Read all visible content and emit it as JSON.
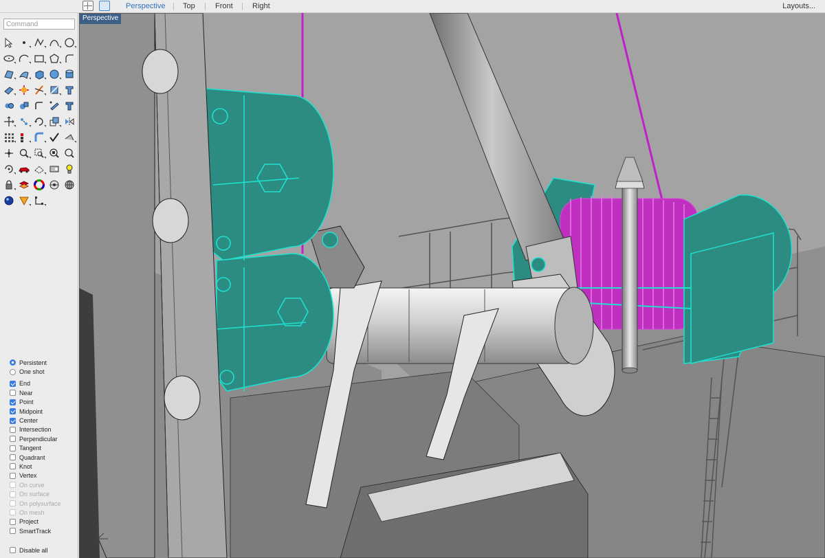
{
  "viewport_tabs": [
    {
      "label": "Perspective",
      "active": true
    },
    {
      "label": "Top",
      "active": false
    },
    {
      "label": "Front",
      "active": false
    },
    {
      "label": "Right",
      "active": false
    }
  ],
  "layouts_label": "Layouts...",
  "command": {
    "placeholder": "Command",
    "value": ""
  },
  "viewport": {
    "label": "Perspective"
  },
  "tools": [
    "select-arrow-icon",
    "point-icon",
    "polyline-icon",
    "curve-icon",
    "circle-icon",
    "ellipse-icon",
    "arc-icon",
    "rectangle-icon",
    "polygon-icon",
    "fillet-curve-icon",
    "surface-corner-points-icon",
    "extrude-surface-icon",
    "box-solid-icon",
    "sphere-icon",
    "cylinder-icon",
    "mesh-plane-icon",
    "explode-icon",
    "trim-icon",
    "split-icon",
    "text-object-icon",
    "join-icon",
    "boolean-union-icon",
    "fillet-edge-icon",
    "edit-points-icon",
    "text-icon",
    "move-icon",
    "copy-icon",
    "rotate-icon",
    "scale-icon",
    "mirror-icon",
    "array-icon",
    "group-icon",
    "bend-icon",
    "check-icon",
    "distance-icon",
    "pan-icon",
    "zoom-icon",
    "zoom-window-icon",
    "zoom-extents-icon",
    "zoom-selected-icon",
    "rotate-view-icon",
    "car-render-icon",
    "named-view-icon",
    "display-mode-icon",
    "light-bulb-icon",
    "lock-icon",
    "layer-icon",
    "color-wheel-icon",
    "render-preview-icon",
    "globe-grid-icon",
    "material-sphere-icon",
    "cone-arrow-icon",
    "gumball-icon"
  ],
  "snap_modes": [
    {
      "label": "Persistent",
      "kind": "radio",
      "on": true,
      "enabled": true
    },
    {
      "label": "One shot",
      "kind": "radio",
      "on": false,
      "enabled": true
    },
    {
      "label": "End",
      "kind": "check",
      "on": true,
      "enabled": true
    },
    {
      "label": "Near",
      "kind": "check",
      "on": false,
      "enabled": true
    },
    {
      "label": "Point",
      "kind": "check",
      "on": true,
      "enabled": true
    },
    {
      "label": "Midpoint",
      "kind": "check",
      "on": true,
      "enabled": true
    },
    {
      "label": "Center",
      "kind": "check",
      "on": true,
      "enabled": true
    },
    {
      "label": "Intersection",
      "kind": "check",
      "on": false,
      "enabled": true
    },
    {
      "label": "Perpendicular",
      "kind": "check",
      "on": false,
      "enabled": true
    },
    {
      "label": "Tangent",
      "kind": "check",
      "on": false,
      "enabled": true
    },
    {
      "label": "Quadrant",
      "kind": "check",
      "on": false,
      "enabled": true
    },
    {
      "label": "Knot",
      "kind": "check",
      "on": false,
      "enabled": true
    },
    {
      "label": "Vertex",
      "kind": "check",
      "on": false,
      "enabled": true
    },
    {
      "label": "On curve",
      "kind": "check",
      "on": false,
      "enabled": false
    },
    {
      "label": "On surface",
      "kind": "check",
      "on": false,
      "enabled": false
    },
    {
      "label": "On polysurface",
      "kind": "check",
      "on": false,
      "enabled": false
    },
    {
      "label": "On mesh",
      "kind": "check",
      "on": false,
      "enabled": false
    },
    {
      "label": "Project",
      "kind": "check",
      "on": false,
      "enabled": true
    },
    {
      "label": "SmartTrack",
      "kind": "check",
      "on": false,
      "enabled": true
    }
  ],
  "disable_all": {
    "label": "Disable all",
    "on": false
  },
  "colors": {
    "accent": "#2f6fbd",
    "selection_cyan": "#1fe0d0",
    "selection_magenta": "#c020c8",
    "viewport_bg": "#9a9a9a"
  }
}
